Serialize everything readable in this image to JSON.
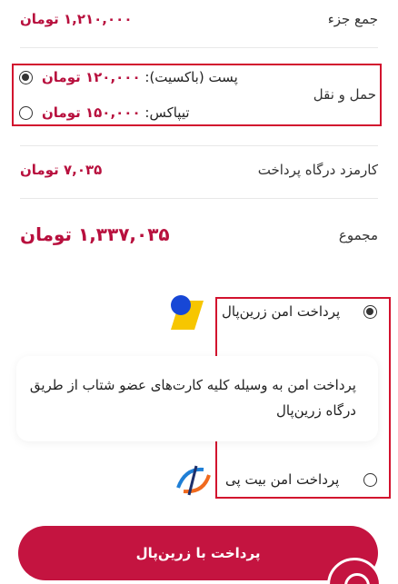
{
  "subtotal": {
    "label": "جمع جزء",
    "value": "۱,۲۱۰,۰۰۰ تومان"
  },
  "shipping": {
    "label": "حمل و نقل",
    "options": [
      {
        "name": "پست (باکسیت):",
        "price": "۱۲۰,۰۰۰ تومان",
        "selected": true
      },
      {
        "name": "تیپاکس:",
        "price": "۱۵۰,۰۰۰ تومان",
        "selected": false
      }
    ]
  },
  "gateway_fee": {
    "label": "کارمزد درگاه پرداخت",
    "value": "۷,۰۳۵ تومان"
  },
  "total": {
    "label": "مجموع",
    "value": "۱,۳۳۷,۰۳۵ تومان"
  },
  "payment_methods": [
    {
      "label": "پرداخت امن زرین‌پال",
      "selected": true,
      "icon": "zarinpal-logo-icon"
    },
    {
      "label": "پرداخت امن بیت پی",
      "selected": false,
      "icon": "bitpay-logo-icon"
    }
  ],
  "payment_description": "پرداخت امن به وسیله کلیه کارت‌های عضو شتاب از طریق درگاه زرین‌پال",
  "submit_button": "پرداخت با زرین‌پال",
  "colors": {
    "accent": "#c41440",
    "highlight_border": "#d2122e"
  }
}
